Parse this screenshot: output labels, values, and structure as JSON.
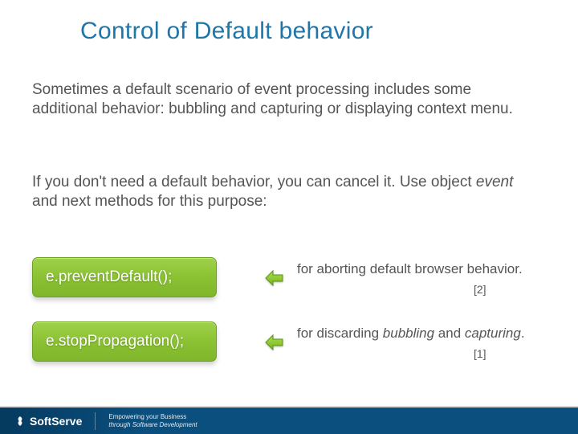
{
  "title": "Control of Default behavior",
  "para1": "Sometimes a default scenario of event processing includes some additional behavior: bubbling and capturing or displaying context menu.",
  "para2_a": "If you don't need a default behavior, you can cancel it. Use object ",
  "para2_ital": "event",
  "para2_b": " and next methods for this purpose:",
  "method1": {
    "code": "e.preventDefault();",
    "desc": "for aborting default browser behavior.",
    "ref": "[2]"
  },
  "method2": {
    "code": "e.stopPropagation();",
    "desc_a": "for discarding ",
    "desc_i1": "bubbling",
    "desc_m": " and ",
    "desc_i2": "capturing",
    "desc_b": ".",
    "ref": "[1]"
  },
  "footer": {
    "brand": "SoftServe",
    "tag1": "Empowering your Business",
    "tag2": "through Software Development"
  }
}
